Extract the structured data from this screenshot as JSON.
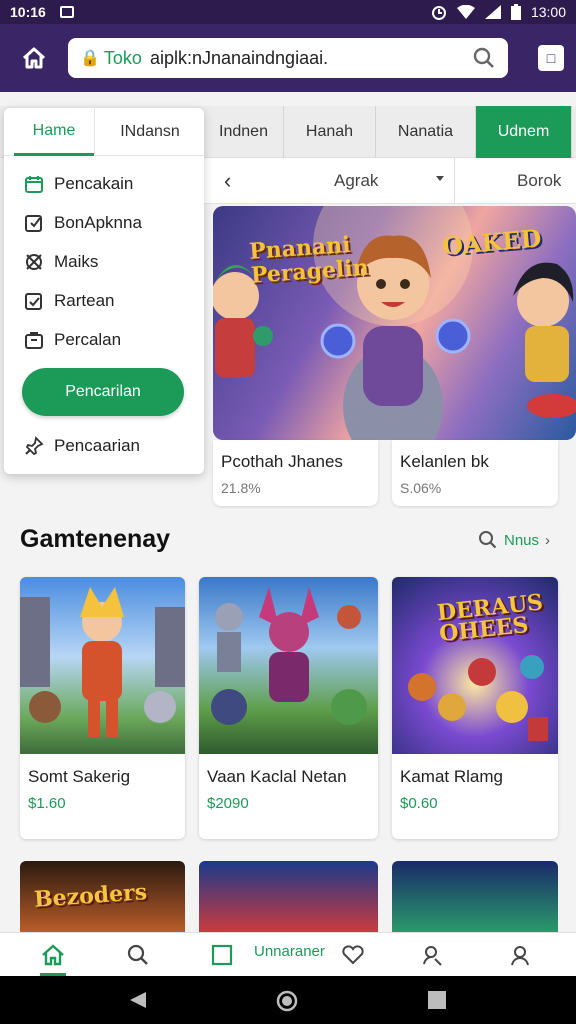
{
  "status_bar": {
    "time_left": "10:16",
    "time_right": "13:00"
  },
  "browser": {
    "url_prefix": "Toko",
    "url_text": "aiplk:nJnanaindngiaai."
  },
  "category_tabs": [
    {
      "label": "Indnen",
      "active": false
    },
    {
      "label": "Hanah",
      "active": false
    },
    {
      "label": "Nanatia",
      "active": false
    },
    {
      "label": "Udnem",
      "active": true
    }
  ],
  "filter": {
    "sort_label": "Agrak",
    "right_label": "Borok"
  },
  "dropdown": {
    "tabs": [
      {
        "label": "Hame",
        "active": true
      },
      {
        "label": "INdansn",
        "active": false
      }
    ],
    "items": [
      {
        "label": "Pencakain",
        "icon": "calendar-icon"
      },
      {
        "label": "BonApknna",
        "icon": "edit-icon"
      },
      {
        "label": "Maiks",
        "icon": "tag-icon"
      },
      {
        "label": "Rartean",
        "icon": "checkbox-icon"
      },
      {
        "label": "Percalan",
        "icon": "bag-icon"
      }
    ],
    "button_label": "Pencarilan",
    "footer_item": "Pencaarian"
  },
  "hero": {
    "title_left": "Pnanani Peragelin",
    "title_right": "OAKED"
  },
  "promos": [
    {
      "name": "Pcothah Jhanes",
      "meta": "21.8%"
    },
    {
      "name": "Kelanlen bk",
      "meta": "S.06%"
    }
  ],
  "section": {
    "title": "Gamtenenay",
    "more_label": "Nnus"
  },
  "games": [
    {
      "name": "Somt Sakerig",
      "price": "$1.60"
    },
    {
      "name": "Vaan Kaclal Netan",
      "price": "$2090"
    },
    {
      "name": "Kamat Rlamg",
      "price": "$0.60",
      "art_title": "DERAUS OHEES"
    }
  ],
  "partial_cards": [
    {
      "title": "Bezoders"
    }
  ],
  "bottom_nav": {
    "active_label": "Unnaraner"
  },
  "colors": {
    "accent": "#1c9a57",
    "header": "#3a2566",
    "status": "#2d1b4e"
  }
}
